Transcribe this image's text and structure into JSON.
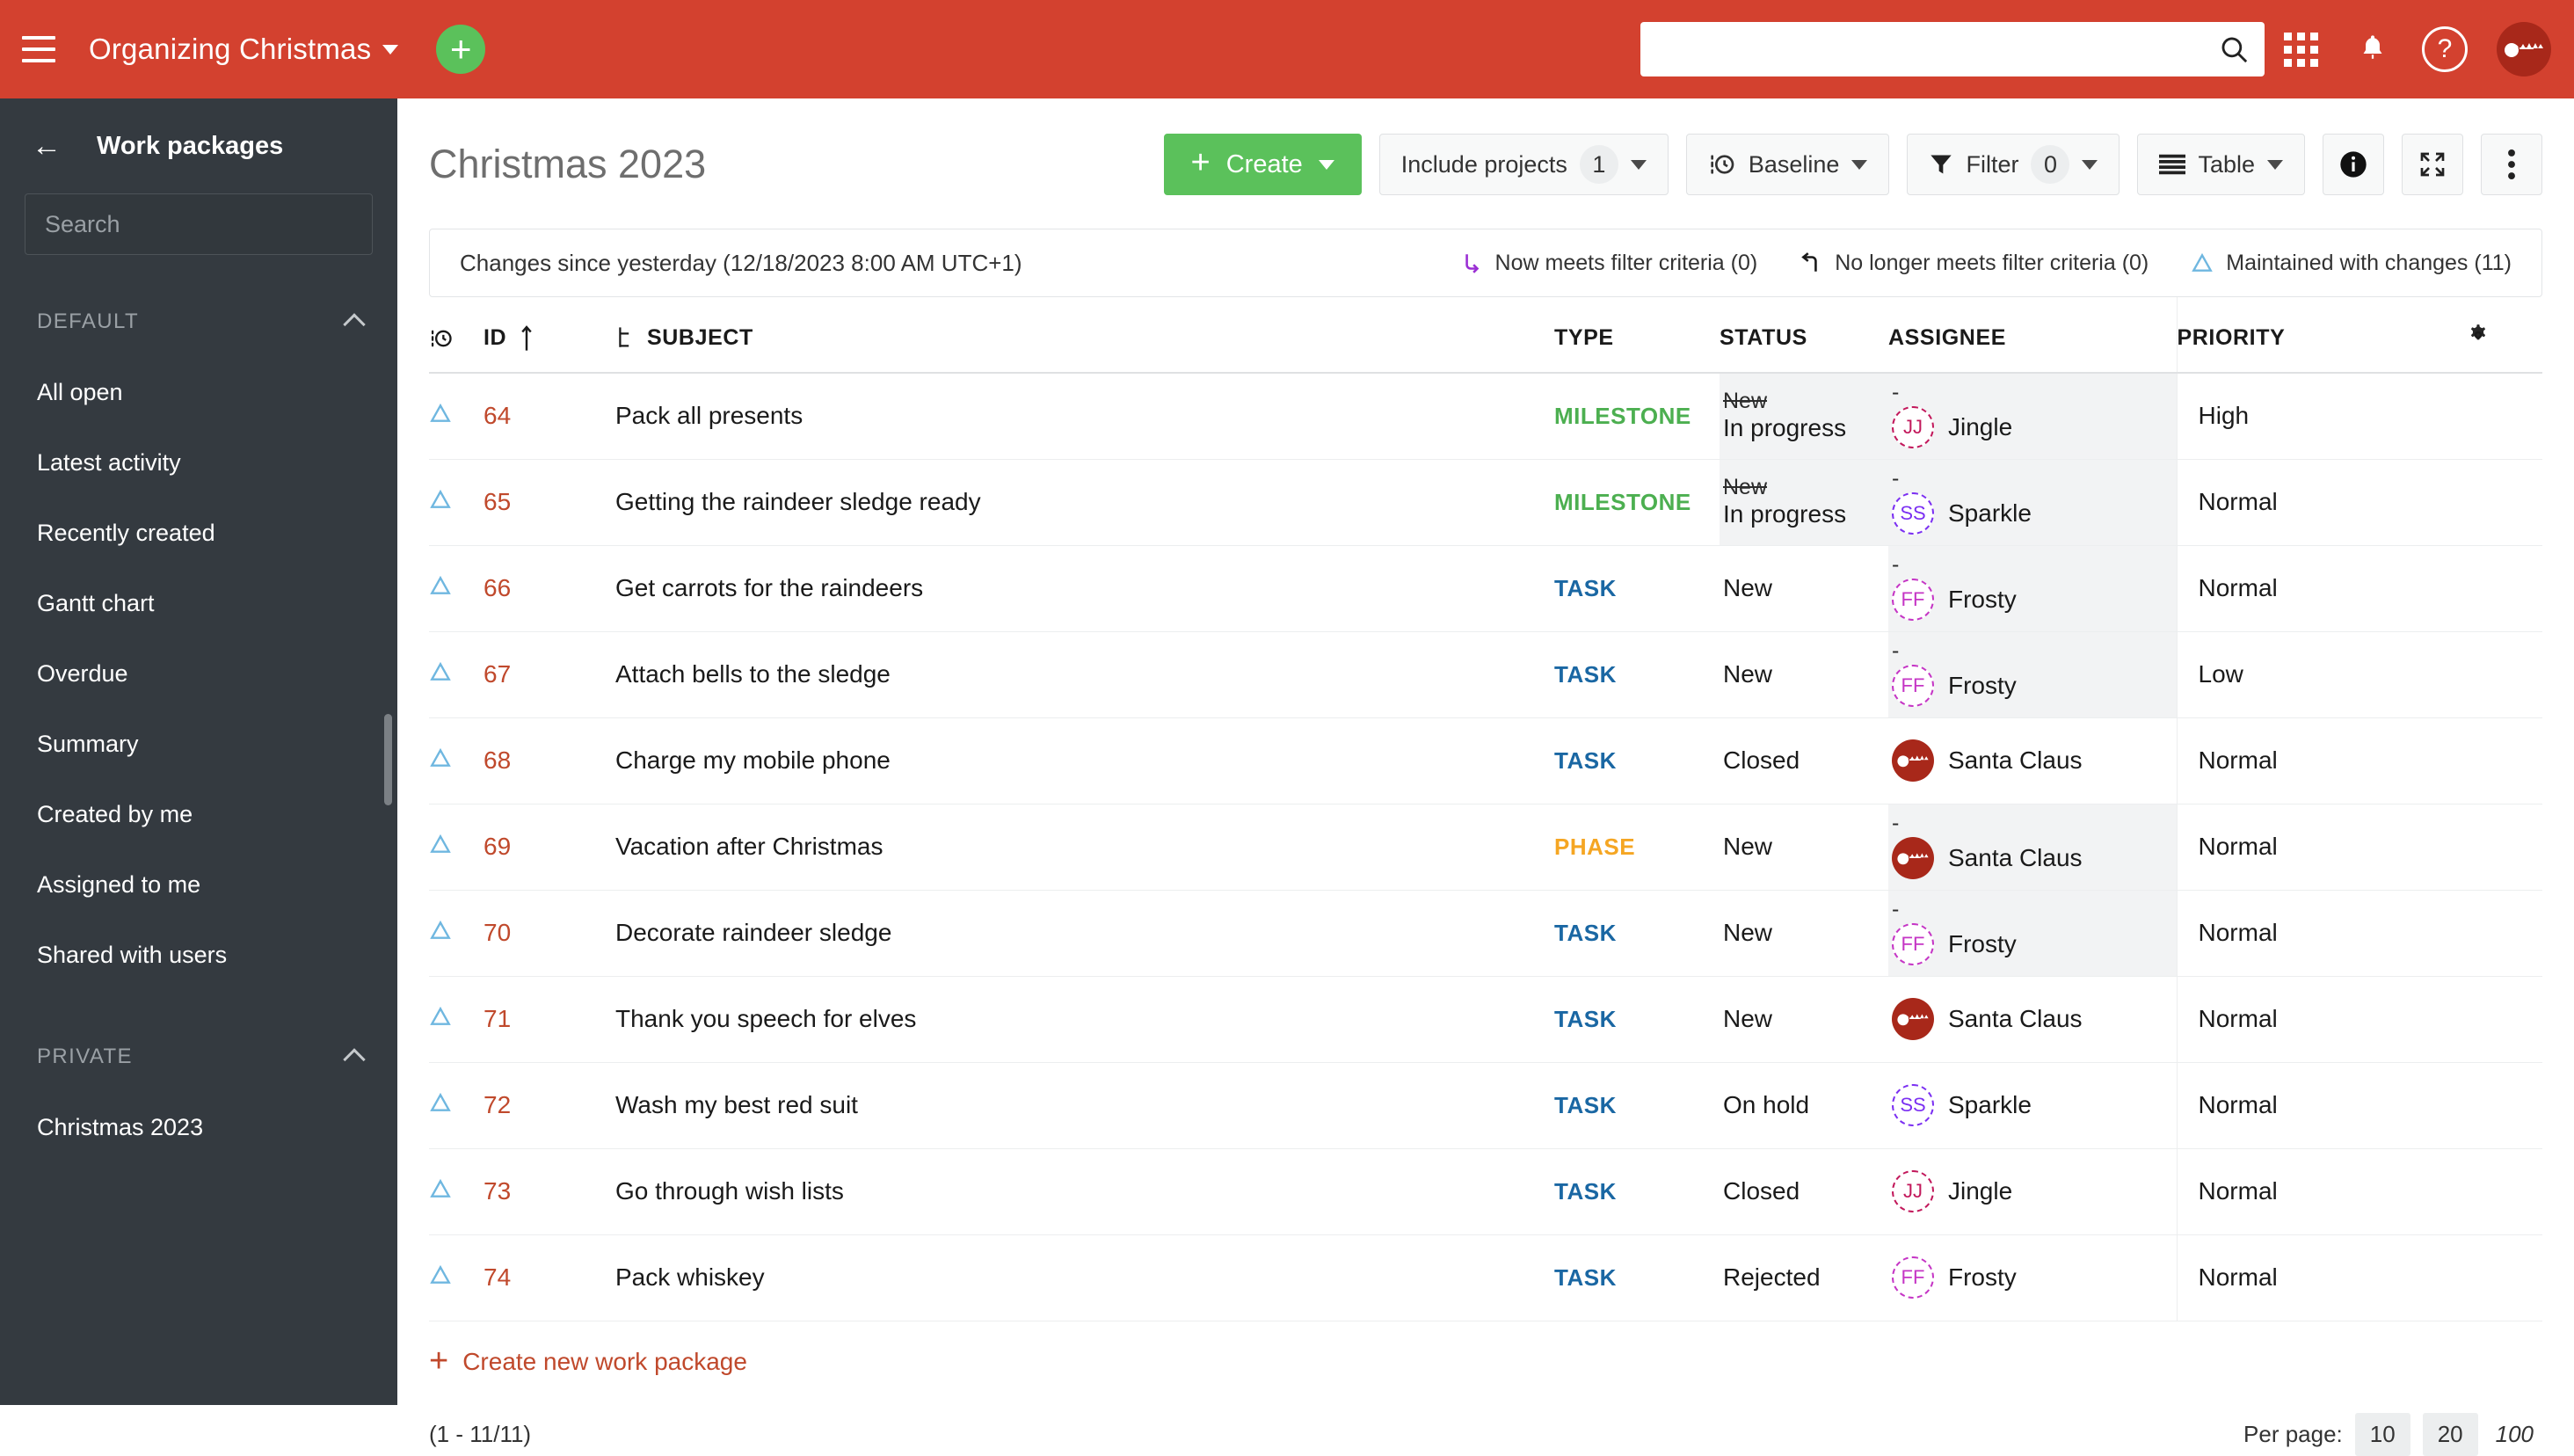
{
  "topbar": {
    "menu_icon": "hamburger-icon",
    "project_name": "Organizing Christmas",
    "create_icon": "plus-icon",
    "search_placeholder": "",
    "search_value": "",
    "search_icon": "search-icon",
    "modules_icon": "grid-apps-icon",
    "notifications_icon": "bell-icon",
    "help_icon": "help-circle-icon",
    "avatar_icon": "santa-avatar"
  },
  "sidebar": {
    "back_icon": "arrow-left-icon",
    "title": "Work packages",
    "search_placeholder": "Search",
    "search_value": "",
    "search_icon": "search-icon",
    "sections": [
      {
        "label": "DEFAULT",
        "collapse_icon": "chevron-up-icon",
        "items": [
          {
            "label": "All open"
          },
          {
            "label": "Latest activity"
          },
          {
            "label": "Recently created"
          },
          {
            "label": "Gantt chart"
          },
          {
            "label": "Overdue"
          },
          {
            "label": "Summary"
          },
          {
            "label": "Created by me"
          },
          {
            "label": "Assigned to me"
          },
          {
            "label": "Shared with users"
          }
        ]
      },
      {
        "label": "PRIVATE",
        "collapse_icon": "chevron-up-icon",
        "items": [
          {
            "label": "Christmas 2023"
          }
        ]
      }
    ]
  },
  "main": {
    "page_title": "Christmas 2023",
    "toolbar": {
      "create_label": "Create",
      "create_icon": "plus-icon",
      "include_projects_label": "Include projects",
      "include_projects_count": "1",
      "baseline_label": "Baseline",
      "baseline_icon": "baseline-clock-icon",
      "filter_label": "Filter",
      "filter_count": "0",
      "filter_icon": "funnel-icon",
      "table_label": "Table",
      "table_icon": "table-rows-icon",
      "info_icon": "info-icon",
      "fullscreen_icon": "expand-icon",
      "more_icon": "kebab-menu-icon"
    },
    "baseline_bar": {
      "text": "Changes since yesterday (12/18/2023 8:00 AM UTC+1)",
      "legend": [
        {
          "icon": "arrow-now-meets-icon",
          "label": "Now meets filter criteria (0)",
          "color": "#9b2fd4"
        },
        {
          "icon": "arrow-no-longer-meets-icon",
          "label": "No longer meets filter criteria (0)",
          "color": "#1a1a1a"
        },
        {
          "icon": "triangle-maintained-icon",
          "label": "Maintained with changes (11)",
          "color": "#6fb7e0"
        }
      ]
    },
    "table": {
      "columns": [
        {
          "key": "baseline",
          "label": "",
          "icon": "baseline-clock-icon"
        },
        {
          "key": "id",
          "label": "ID",
          "sort_icon": "sort-asc-icon"
        },
        {
          "key": "subject",
          "label": "SUBJECT",
          "icon": "hierarchy-icon"
        },
        {
          "key": "type",
          "label": "TYPE"
        },
        {
          "key": "status",
          "label": "STATUS"
        },
        {
          "key": "assignee",
          "label": "ASSIGNEE"
        },
        {
          "key": "priority",
          "label": "PRIORITY"
        },
        {
          "key": "settings",
          "label": "",
          "icon": "gear-icon"
        }
      ],
      "rows": [
        {
          "marker_icon": "triangle-maintained-icon",
          "id": "64",
          "subject": "Pack all presents",
          "type": "MILESTONE",
          "type_class": "milestone",
          "status": "In progress",
          "status_old": "New",
          "status_changed": true,
          "assignee": "Jingle",
          "assignee_initials": "JJ",
          "assignee_old": "-",
          "assignee_changed": true,
          "assignee_color": "#c2185b",
          "assignee_avatar": "initials",
          "priority": "High"
        },
        {
          "marker_icon": "triangle-maintained-icon",
          "id": "65",
          "subject": "Getting the raindeer sledge ready",
          "type": "MILESTONE",
          "type_class": "milestone",
          "status": "In progress",
          "status_old": "New",
          "status_changed": true,
          "assignee": "Sparkle",
          "assignee_initials": "SS",
          "assignee_old": "-",
          "assignee_changed": true,
          "assignee_color": "#7b2ff2",
          "assignee_avatar": "initials",
          "priority": "Normal"
        },
        {
          "marker_icon": "triangle-maintained-icon",
          "id": "66",
          "subject": "Get carrots for the raindeers",
          "type": "TASK",
          "type_class": "task",
          "status": "New",
          "status_old": "",
          "status_changed": false,
          "assignee": "Frosty",
          "assignee_initials": "FF",
          "assignee_old": "-",
          "assignee_changed": true,
          "assignee_color": "#c535c5",
          "assignee_avatar": "initials",
          "priority": "Normal"
        },
        {
          "marker_icon": "triangle-maintained-icon",
          "id": "67",
          "subject": "Attach bells to the sledge",
          "type": "TASK",
          "type_class": "task",
          "status": "New",
          "status_old": "",
          "status_changed": false,
          "assignee": "Frosty",
          "assignee_initials": "FF",
          "assignee_old": "-",
          "assignee_changed": true,
          "assignee_color": "#c535c5",
          "assignee_avatar": "initials",
          "priority": "Low"
        },
        {
          "marker_icon": "triangle-maintained-icon",
          "id": "68",
          "subject": "Charge my mobile phone",
          "type": "TASK",
          "type_class": "task",
          "status": "Closed",
          "status_old": "",
          "status_changed": false,
          "assignee": "Santa Claus",
          "assignee_initials": "",
          "assignee_old": "",
          "assignee_changed": false,
          "assignee_color": "#a8281a",
          "assignee_avatar": "santa",
          "priority": "Normal"
        },
        {
          "marker_icon": "triangle-maintained-icon",
          "id": "69",
          "subject": "Vacation after Christmas",
          "type": "PHASE",
          "type_class": "phase",
          "status": "New",
          "status_old": "",
          "status_changed": false,
          "assignee": "Santa Claus",
          "assignee_initials": "",
          "assignee_old": "-",
          "assignee_changed": true,
          "assignee_color": "#a8281a",
          "assignee_avatar": "santa",
          "priority": "Normal"
        },
        {
          "marker_icon": "triangle-maintained-icon",
          "id": "70",
          "subject": "Decorate raindeer sledge",
          "type": "TASK",
          "type_class": "task",
          "status": "New",
          "status_old": "",
          "status_changed": false,
          "assignee": "Frosty",
          "assignee_initials": "FF",
          "assignee_old": "-",
          "assignee_changed": true,
          "assignee_color": "#c535c5",
          "assignee_avatar": "initials",
          "priority": "Normal"
        },
        {
          "marker_icon": "triangle-maintained-icon",
          "id": "71",
          "subject": "Thank you speech for elves",
          "type": "TASK",
          "type_class": "task",
          "status": "New",
          "status_old": "",
          "status_changed": false,
          "assignee": "Santa Claus",
          "assignee_initials": "",
          "assignee_old": "",
          "assignee_changed": false,
          "assignee_color": "#a8281a",
          "assignee_avatar": "santa",
          "priority": "Normal"
        },
        {
          "marker_icon": "triangle-maintained-icon",
          "id": "72",
          "subject": "Wash my best red suit",
          "type": "TASK",
          "type_class": "task",
          "status": "On hold",
          "status_old": "",
          "status_changed": false,
          "assignee": "Sparkle",
          "assignee_initials": "SS",
          "assignee_old": "",
          "assignee_changed": false,
          "assignee_color": "#7b2ff2",
          "assignee_avatar": "initials",
          "priority": "Normal"
        },
        {
          "marker_icon": "triangle-maintained-icon",
          "id": "73",
          "subject": "Go through wish lists",
          "type": "TASK",
          "type_class": "task",
          "status": "Closed",
          "status_old": "",
          "status_changed": false,
          "assignee": "Jingle",
          "assignee_initials": "JJ",
          "assignee_old": "",
          "assignee_changed": false,
          "assignee_color": "#c2185b",
          "assignee_avatar": "initials",
          "priority": "Normal"
        },
        {
          "marker_icon": "triangle-maintained-icon",
          "id": "74",
          "subject": "Pack whiskey",
          "type": "TASK",
          "type_class": "task",
          "status": "Rejected",
          "status_old": "",
          "status_changed": false,
          "assignee": "Frosty",
          "assignee_initials": "FF",
          "assignee_old": "",
          "assignee_changed": false,
          "assignee_color": "#c535c5",
          "assignee_avatar": "initials",
          "priority": "Normal"
        }
      ]
    },
    "create_new_label": "Create new work package",
    "create_new_icon": "plus-icon",
    "footer": {
      "range": "(1 - 11/11)",
      "per_page_label": "Per page:",
      "per_page_options": [
        "10",
        "20"
      ],
      "per_page_current": "100"
    }
  },
  "colors": {
    "brand_red": "#d3412f",
    "sidebar_dark": "#343a40",
    "green": "#5bc15b",
    "link_orange": "#c0492c",
    "baseline_blue": "#6fb7e0"
  }
}
